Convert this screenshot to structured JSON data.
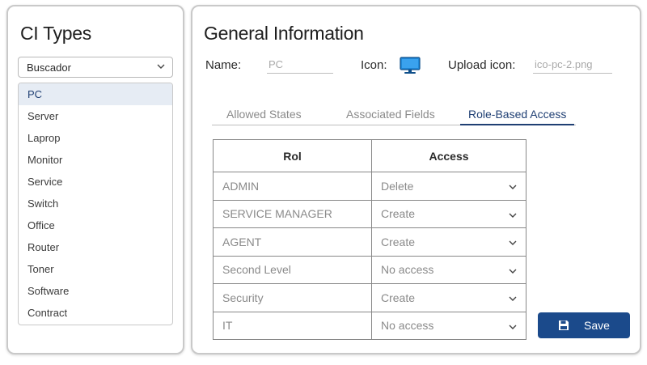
{
  "left": {
    "title": "CI Types",
    "search": {
      "value": "Buscador",
      "icon": "chevron-down-icon"
    },
    "items": [
      {
        "label": "PC",
        "selected": true
      },
      {
        "label": "Server"
      },
      {
        "label": "Laprop"
      },
      {
        "label": "Monitor"
      },
      {
        "label": "Service"
      },
      {
        "label": "Switch"
      },
      {
        "label": "Office"
      },
      {
        "label": "Router"
      },
      {
        "label": "Toner"
      },
      {
        "label": "Software"
      },
      {
        "label": "Contract"
      }
    ]
  },
  "main": {
    "title": "General Information",
    "name_label": "Name:",
    "name_value": "PC",
    "icon_label": "Icon:",
    "icon": "monitor-icon",
    "upload_label": "Upload icon:",
    "upload_value": "ico-pc-2.png",
    "tabs": [
      {
        "label": "Allowed States"
      },
      {
        "label": "Associated Fields"
      },
      {
        "label": "Role-Based Access",
        "active": true
      }
    ],
    "table": {
      "headers": [
        "Rol",
        "Access"
      ],
      "rows": [
        {
          "role": "ADMIN",
          "access": "Delete"
        },
        {
          "role": "SERVICE MANAGER",
          "access": "Create"
        },
        {
          "role": "AGENT",
          "access": "Create"
        },
        {
          "role": "Second Level",
          "access": "No access"
        },
        {
          "role": "Security",
          "access": "Create"
        },
        {
          "role": "IT",
          "access": "No access"
        }
      ]
    },
    "save_label": "Save",
    "save_icon": "floppy-disk-icon"
  },
  "colors": {
    "accent": "#1b4a8b",
    "active_tab": "#1f3f73",
    "selected_item_bg": "#e6ecf4",
    "monitor_icon": "#1e88d8"
  }
}
